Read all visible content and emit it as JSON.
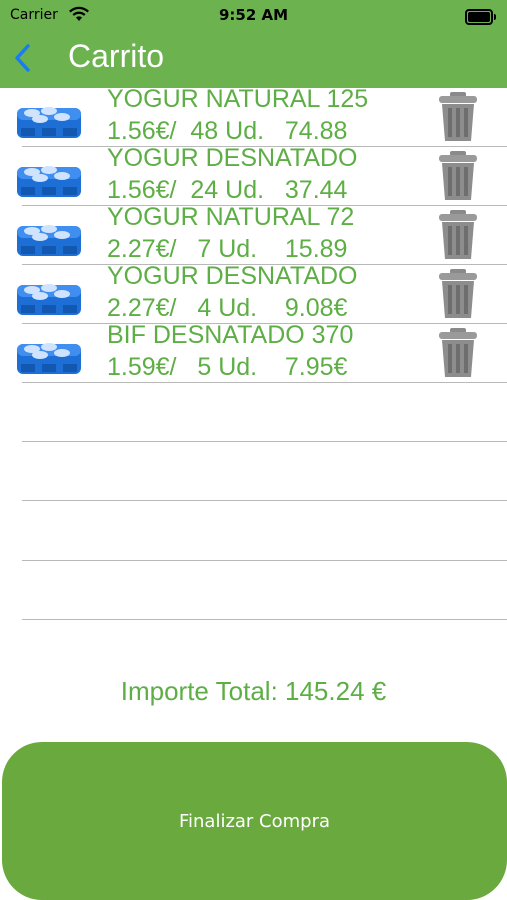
{
  "status_bar": {
    "carrier": "Carrier",
    "time": "9:52 AM"
  },
  "nav": {
    "title": "Carrito",
    "back_icon": "chevron-left-icon"
  },
  "items": [
    {
      "name": "YOGUR NATURAL 125",
      "detail": "1.56€/  48 Ud.   74.88"
    },
    {
      "name": "YOGUR DESNATADO",
      "detail": "1.56€/  24 Ud.   37.44"
    },
    {
      "name": "YOGUR NATURAL 72",
      "detail": "2.27€/   7 Ud.    15.89"
    },
    {
      "name": "YOGUR DESNATADO",
      "detail": "2.27€/   4 Ud.    9.08€"
    },
    {
      "name": "BIF DESNATADO 370",
      "detail": "1.59€/   5 Ud.    7.95€"
    }
  ],
  "total": {
    "text": "Importe Total: 145.24 €"
  },
  "finish_button": {
    "label": "Finalizar Compra"
  },
  "colors": {
    "accent": "#6cb24f",
    "text_green": "#5eae46",
    "button": "#6aa93d"
  }
}
